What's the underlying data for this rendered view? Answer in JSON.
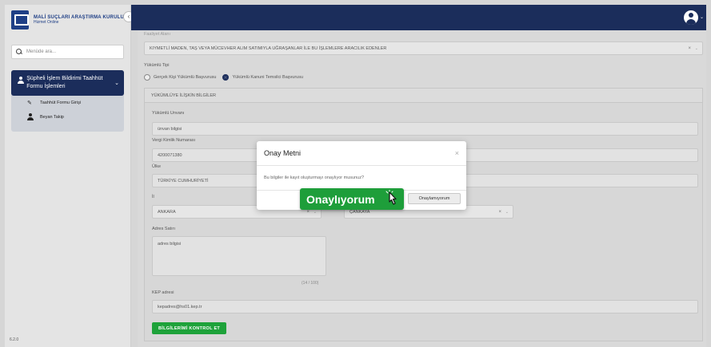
{
  "brand": {
    "title": "MALİ SUÇLARI ARAŞTIRMA KURULU",
    "subtitle": "Hizmet Online",
    "collapse_icon": "chevron-left"
  },
  "sidebar": {
    "search_placeholder": "Menüde ara...",
    "group_label": "Şüpheli İşlem Bildirimi Taahhüt Formu İşlemleri",
    "items": [
      {
        "label": "Taahhüt Formu Girişi",
        "icon": "pencil"
      },
      {
        "label": "Beyan Takip",
        "icon": "user"
      }
    ],
    "version": "6.2.0"
  },
  "form": {
    "faded_top_label": "Faaliyet Alanı",
    "sector_value": "KIYMETLİ MADEN, TAŞ VEYA MÜCEVHER ALIM SATIMIYLA UĞRAŞANLAR İLE BU İŞLEMLERE ARACILIK EDENLER",
    "obligor_type_label": "Yükümlü Tipi",
    "radio_real": "Gerçek Kişi Yükümlü Başvurusu",
    "radio_legal": "Yükümlü Kanuni Temsilci Başvurusu",
    "panel_title": "YÜKÜMLÜYE İLİŞKİN BİLGİLER",
    "title_label": "Yükümlü Unvanı",
    "title_value": "ünvan bilgisi",
    "tax_label": "Vergi Kimlik Numarası",
    "tax_value": "4200071380",
    "country_label": "Ülke",
    "country_value": "TÜRKİYE CUMHURİYETİ",
    "city_label": "İl",
    "city_value": "ANKARA",
    "district_value": "ÇANKAYA",
    "address_label": "Adres Satırı",
    "address_value": "adres bilgisi",
    "address_counter": "(14 / 100)",
    "kep_label": "KEP adresi",
    "kep_value": "kepadres@hs01.kep.tr",
    "check_button": "BİLGİLERİMİ KONTROL ET"
  },
  "modal": {
    "title": "Onay Metni",
    "close": "×",
    "body": "Bu bilgiler ile kayıt oluşturmayı onaylıyor musunuz?",
    "confirm": "Onaylıyorum",
    "reject": "Onaylamıyorum"
  },
  "colors": {
    "navy": "#1b2d5b",
    "green": "#1e9e3a"
  }
}
